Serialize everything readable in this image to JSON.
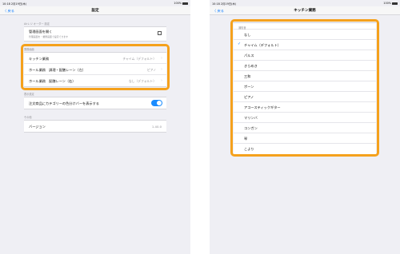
{
  "colors": {
    "accent": "#0a7aff",
    "highlight": "#f5a11c",
    "toggle_on": "#1a8cff"
  },
  "left": {
    "status": {
      "time": "10:18",
      "date": "2月19日(木)",
      "wifi": "wifi-icon",
      "battery": "100%"
    },
    "nav": {
      "back": "〈 戻る",
      "title": "設定"
    },
    "sections": {
      "order_mgmt": {
        "header": "Airレジ オーダー 設定",
        "open_label": "管理画面を開く",
        "open_sub": "管理画面を・業務画面で設定できます",
        "open_icon": "external-link-icon"
      },
      "sound": {
        "header": "業務画面",
        "rows": [
          {
            "label": "キッチン業務",
            "value": "チャイム（デフォルト）"
          },
          {
            "label": "ホール業務　調理・配膳レーン（左）",
            "value": "ピアノ"
          },
          {
            "label": "ホール業務　配膳レーン（右）",
            "value": "なし（デフォルト）"
          }
        ]
      },
      "display": {
        "header": "表示設定",
        "toggle_label": "注文商品にカテゴリーの色分けバーを表示する",
        "toggle_state": "on"
      },
      "info": {
        "header": "その他",
        "version_label": "バージョン",
        "version_value": "1.40.0"
      }
    }
  },
  "right": {
    "status": {
      "time": "10:18",
      "date": "2月19日(木)",
      "wifi": "wifi-icon",
      "battery": "100%"
    },
    "nav": {
      "back": "〈 戻る",
      "title": "キッチン業務"
    },
    "picker": {
      "header": "通知音",
      "selected_index": 1,
      "options": [
        "なし",
        "チャイム（デフォルト）",
        "パルス",
        "きらめき",
        "三和",
        "ポーン",
        "ピアノ",
        "アコースティックギター",
        "マリンバ",
        "コンガン",
        "琴",
        "こより"
      ]
    }
  }
}
